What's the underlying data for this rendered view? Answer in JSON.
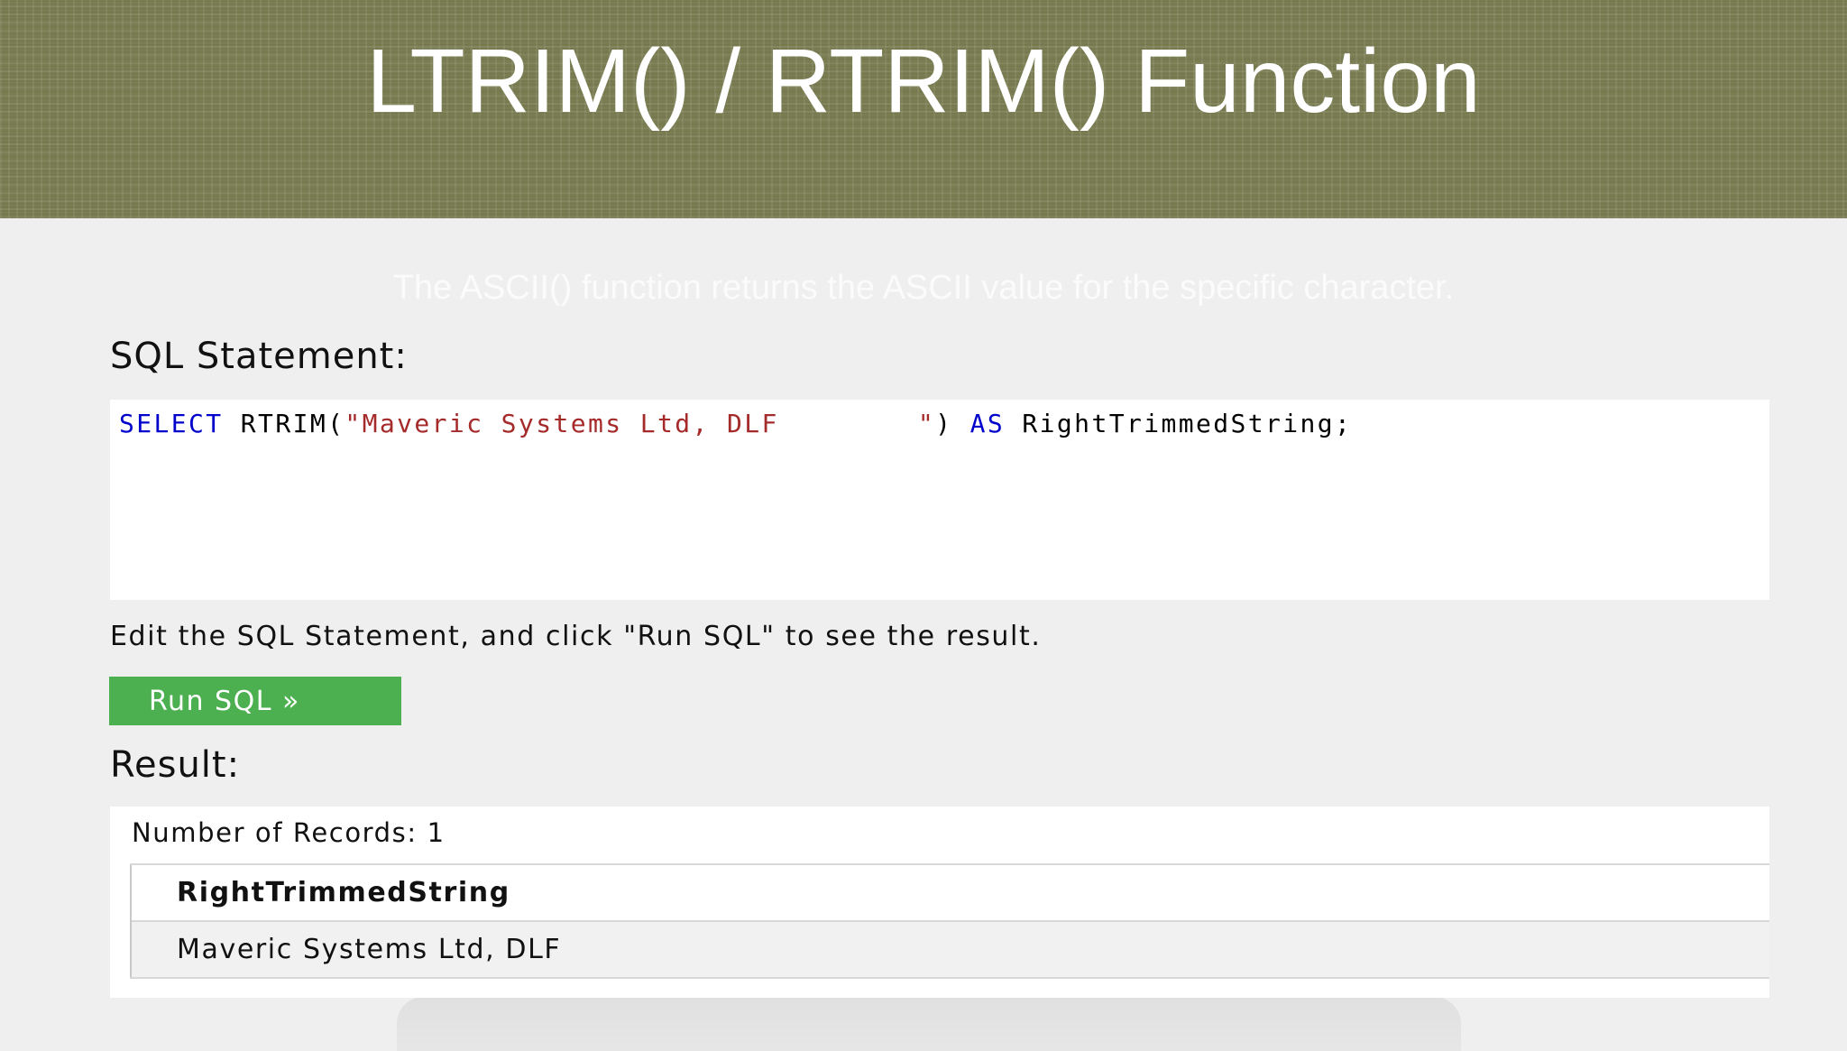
{
  "slide": {
    "title": "LTRIM() / RTRIM() Function",
    "faded_text": "The ASCII() function returns the ASCII value for the specific character."
  },
  "editor": {
    "label": "SQL Statement:",
    "code_parts": {
      "select_kw": "SELECT",
      "fn_open": " RTRIM(",
      "string_literal": "\"Maveric Systems Ltd, DLF        \"",
      "fn_close": ") ",
      "as_kw": "AS",
      "alias": " RightTrimmedString;"
    },
    "instructions": "Edit the SQL Statement, and click \"Run SQL\" to see the result.",
    "run_button_label": "Run SQL »"
  },
  "result": {
    "label": "Result:",
    "record_count": "Number of Records: 1",
    "columns": [
      "RightTrimmedString"
    ],
    "rows": [
      [
        "Maveric Systems Ltd, DLF"
      ]
    ]
  },
  "colors": {
    "header_bg": "#7a7d52",
    "keyword": "#0000cd",
    "string": "#a52a2a",
    "run_button": "#4caf50"
  }
}
